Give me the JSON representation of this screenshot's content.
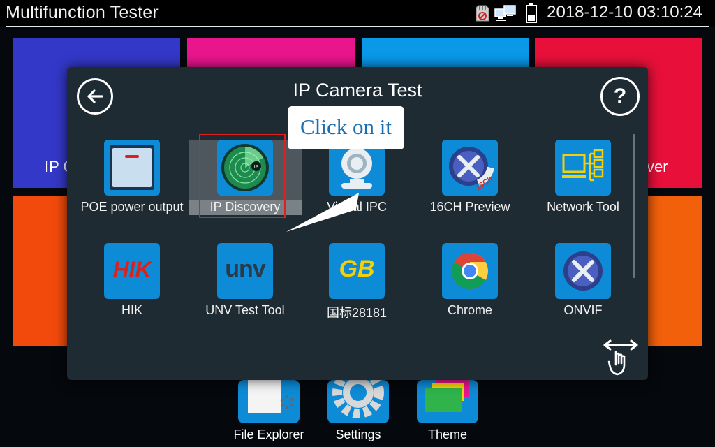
{
  "status_bar": {
    "title": "Multifunction Tester",
    "datetime": "2018-12-10 03:10:24",
    "icons": [
      "sd-card-icon",
      "network-computers-icon",
      "battery-icon"
    ]
  },
  "background": {
    "tiles": [
      {
        "label": "IP C",
        "color": "#3338c8"
      },
      {
        "label": "",
        "color": "#e8158c"
      },
      {
        "label": "",
        "color": "#0a98e8"
      },
      {
        "label": "ver",
        "color": "#e8103a"
      },
      {
        "label": "",
        "color": "#f24a0c"
      },
      {
        "label": "",
        "color": "#f2600c"
      }
    ],
    "dock": [
      {
        "label": "File Explorer",
        "icon": "file-explorer-icon"
      },
      {
        "label": "Settings",
        "icon": "settings-gear-icon"
      },
      {
        "label": "Theme",
        "icon": "theme-icon"
      }
    ]
  },
  "dialog": {
    "title": "IP Camera Test",
    "back_icon": "back-arrow-icon",
    "help_icon": "help-icon",
    "callout": "Click on it",
    "selected_app": "IP Discovery",
    "apps_row1": [
      {
        "label": "POE power output",
        "icon": "poe-power-icon"
      },
      {
        "label": "IP Discovery",
        "icon": "radar-icon"
      },
      {
        "label": "Virtual IPC",
        "icon": "webcam-icon"
      },
      {
        "label": "16CH Preview",
        "icon": "tools-16ch-icon",
        "badge": "16Ch"
      },
      {
        "label": "Network Tool",
        "icon": "network-tool-icon"
      }
    ],
    "apps_row2": [
      {
        "label": "HIK",
        "icon": "hik-logo-icon",
        "logo_text": "HIK"
      },
      {
        "label": "UNV Test Tool",
        "icon": "unv-logo-icon",
        "logo_text": "unv"
      },
      {
        "label": "国标28181",
        "icon": "gb-logo-icon",
        "logo_text": "GB"
      },
      {
        "label": "Chrome",
        "icon": "chrome-icon"
      },
      {
        "label": "ONVIF",
        "icon": "onvif-tools-icon"
      }
    ],
    "radar_text": "IP"
  }
}
